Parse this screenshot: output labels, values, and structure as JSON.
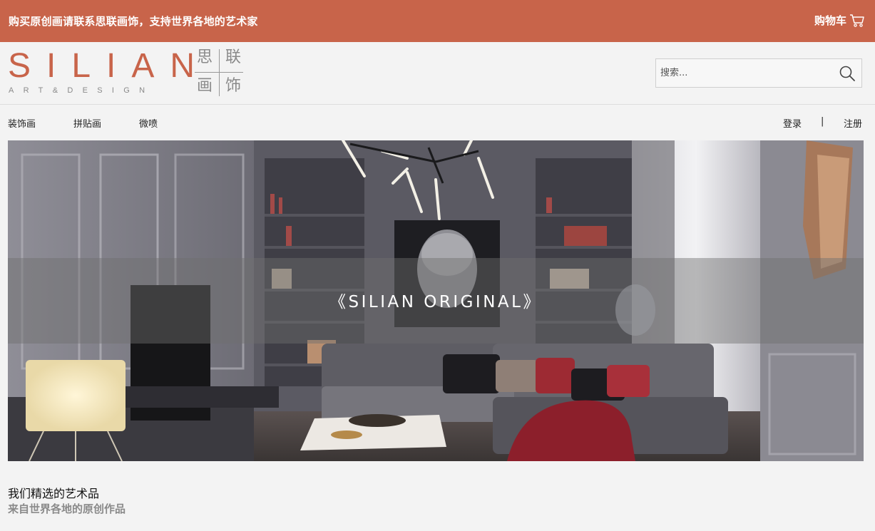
{
  "topbar": {
    "notice": "购买原创画请联系思联画饰，支持世界各地的艺术家",
    "cart_label": "购物车",
    "cart_icon": "cart-icon",
    "background": "#c8644a"
  },
  "logo": {
    "brand": "SILIAN",
    "tagline": "ART&DESIGN",
    "chinese": [
      "思",
      "联",
      "画",
      "饰"
    ],
    "brand_color": "#c8644a"
  },
  "search": {
    "placeholder": "搜索...",
    "value": "",
    "icon": "search-icon"
  },
  "nav": {
    "items": [
      {
        "label": "装饰画"
      },
      {
        "label": "拼贴画"
      },
      {
        "label": "微喷"
      }
    ],
    "login": "登录",
    "separator": "|",
    "register": "注册"
  },
  "hero": {
    "caption": "《SILIAN ORIGINAL》"
  },
  "featured": {
    "title": "我们精选的艺术品",
    "subtitle": "来自世界各地的原创作品"
  }
}
